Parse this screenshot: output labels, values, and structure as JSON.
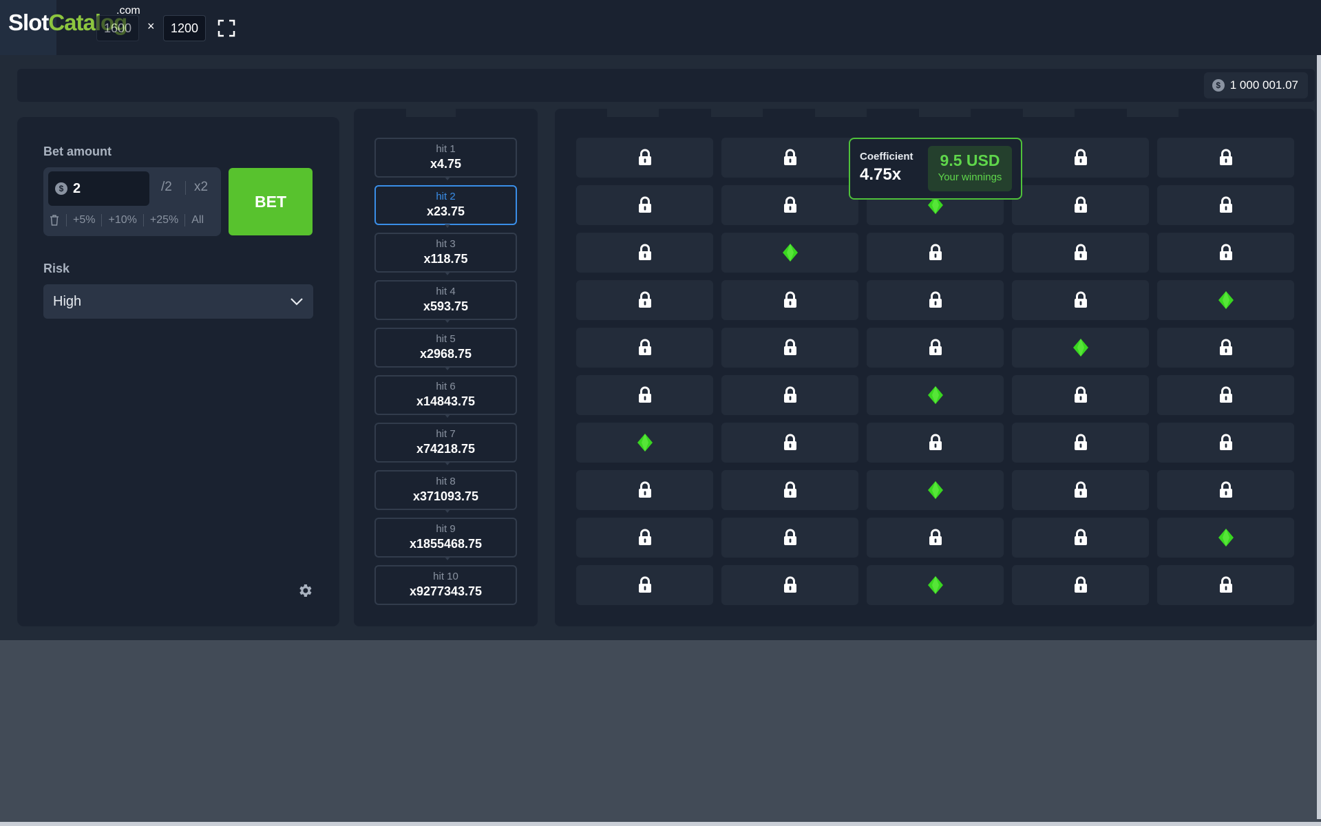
{
  "site": {
    "logo_slot": "Slot",
    "logo_catalog": "Catalog",
    "logo_dotcom": ".com",
    "width_value": "1600",
    "times": "×",
    "height_value": "1200",
    "fullscreen_icon": "fullscreen-icon"
  },
  "balance": {
    "amount": "1 000 001.07",
    "coin_symbol": "$"
  },
  "bet_panel": {
    "bet_amount_label": "Bet amount",
    "coin_symbol": "$",
    "bet_value": "2",
    "half_label": "/2",
    "double_label": "x2",
    "quick": [
      "+5%",
      "+10%",
      "+25%",
      "All"
    ],
    "bet_button": "BET",
    "risk_label": "Risk",
    "risk_value": "High"
  },
  "hits": [
    {
      "label": "hit 1",
      "mult": "x4.75"
    },
    {
      "label": "hit 2",
      "mult": "x23.75"
    },
    {
      "label": "hit 3",
      "mult": "x118.75"
    },
    {
      "label": "hit 4",
      "mult": "x593.75"
    },
    {
      "label": "hit 5",
      "mult": "x2968.75"
    },
    {
      "label": "hit 6",
      "mult": "x14843.75"
    },
    {
      "label": "hit 7",
      "mult": "x74218.75"
    },
    {
      "label": "hit 8",
      "mult": "x371093.75"
    },
    {
      "label": "hit 9",
      "mult": "x1855468.75"
    },
    {
      "label": "hit 10",
      "mult": "x9277343.75"
    }
  ],
  "active_hit": 2,
  "grid": {
    "columns": 5,
    "rows": 10,
    "gem_color": "#39d620",
    "gems": [
      [
        1,
        2
      ],
      [
        2,
        1
      ],
      [
        3,
        4
      ],
      [
        4,
        3
      ],
      [
        5,
        2
      ],
      [
        6,
        0
      ],
      [
        7,
        2
      ],
      [
        8,
        4
      ],
      [
        9,
        2
      ]
    ]
  },
  "coefficient_tip": {
    "title": "Coefficient",
    "value": "4.75x",
    "winnings": "9.5 USD",
    "winnings_label": "Your winnings"
  },
  "colors": {
    "accent_green": "#58c22e",
    "active_blue": "#3a8ee8",
    "panel": "#1a2230",
    "cell": "#232c3a"
  }
}
